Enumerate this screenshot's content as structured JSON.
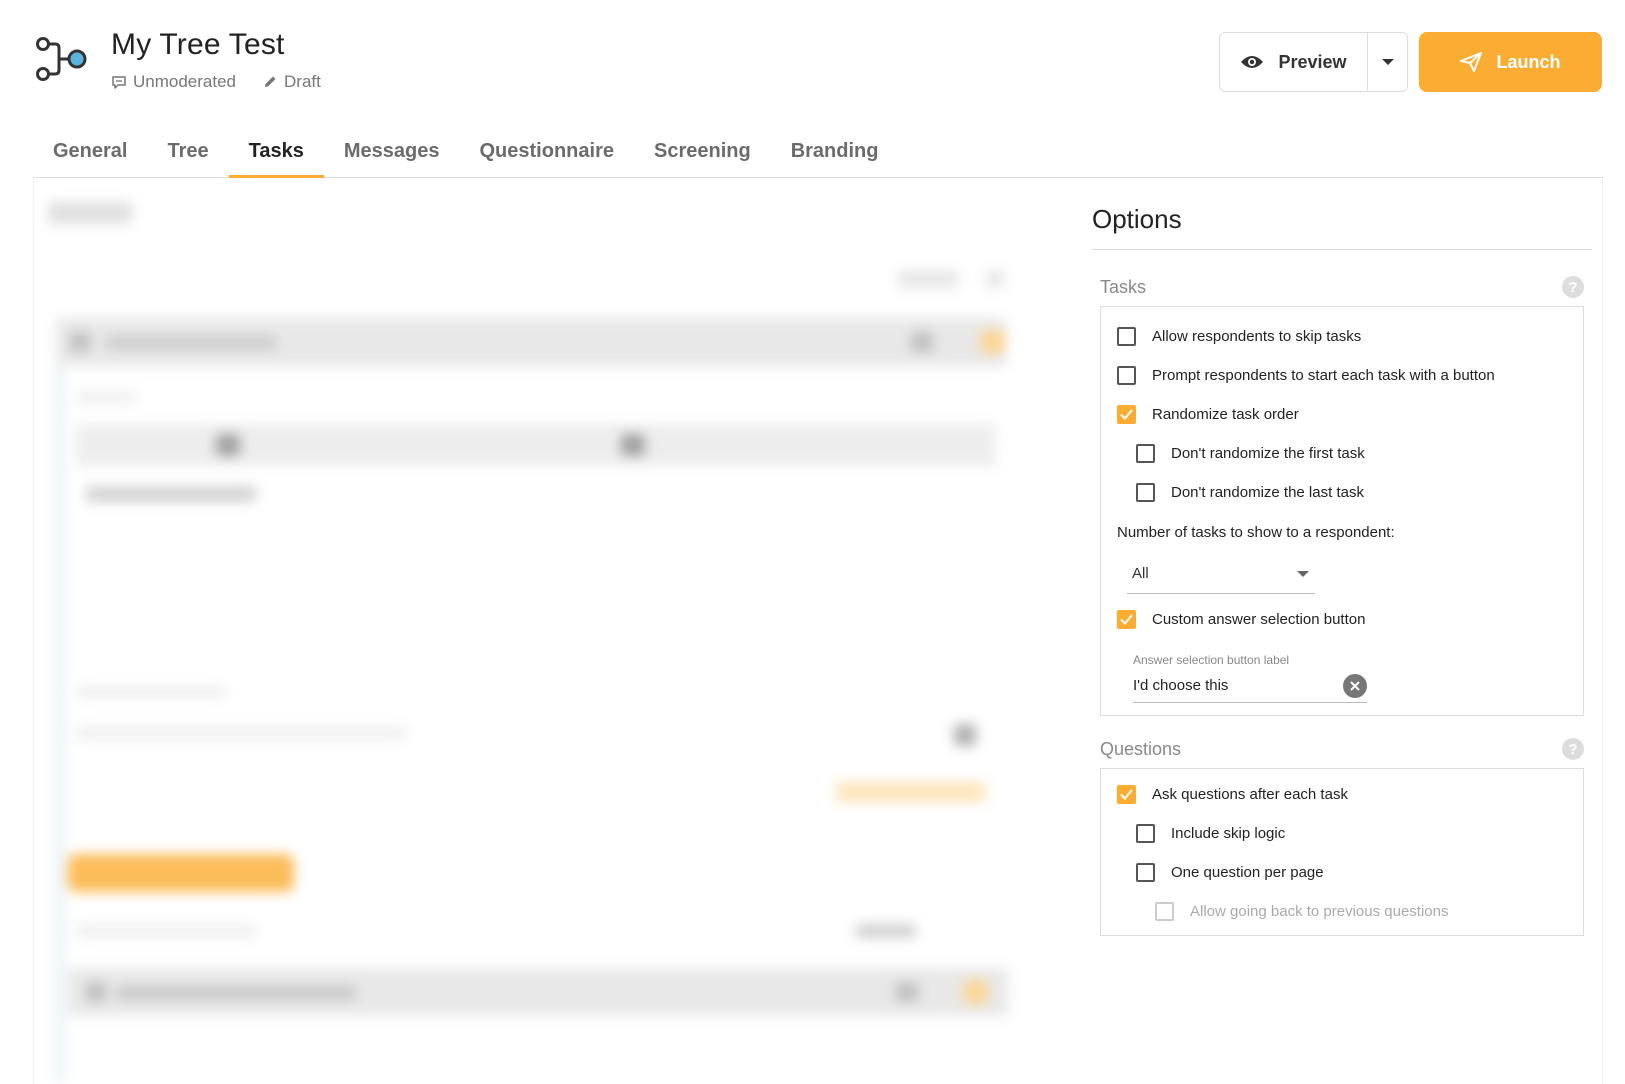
{
  "header": {
    "title": "My Tree Test",
    "mode": "Unmoderated",
    "status": "Draft",
    "preview_label": "Preview",
    "launch_label": "Launch"
  },
  "tabs": [
    {
      "label": "General"
    },
    {
      "label": "Tree"
    },
    {
      "label": "Tasks",
      "active": true
    },
    {
      "label": "Messages"
    },
    {
      "label": "Questionnaire"
    },
    {
      "label": "Screening"
    },
    {
      "label": "Branding"
    }
  ],
  "options": {
    "title": "Options",
    "tasks_section": {
      "label": "Tasks",
      "allow_skip": {
        "label": "Allow respondents to skip tasks",
        "checked": false
      },
      "prompt_start": {
        "label": "Prompt respondents to start each task with a button",
        "checked": false
      },
      "randomize": {
        "label": "Randomize task order",
        "checked": true
      },
      "no_random_first": {
        "label": "Don't randomize the first task",
        "checked": false
      },
      "no_random_last": {
        "label": "Don't randomize the last task",
        "checked": false
      },
      "num_tasks_label": "Number of tasks to show to a respondent:",
      "num_tasks_value": "All",
      "custom_answer": {
        "label": "Custom answer selection button",
        "checked": true
      },
      "answer_field_label": "Answer selection button label",
      "answer_field_value": "I'd choose this"
    },
    "questions_section": {
      "label": "Questions",
      "ask_after": {
        "label": "Ask questions after each task",
        "checked": true
      },
      "skip_logic": {
        "label": "Include skip logic",
        "checked": false
      },
      "one_per_page": {
        "label": "One question per page",
        "checked": false
      },
      "go_back": {
        "label": "Allow going back to previous questions",
        "checked": false,
        "disabled": true
      }
    }
  },
  "colors": {
    "accent": "#fbad33",
    "text": "#222222",
    "muted": "#888888",
    "border": "#dddddd"
  }
}
